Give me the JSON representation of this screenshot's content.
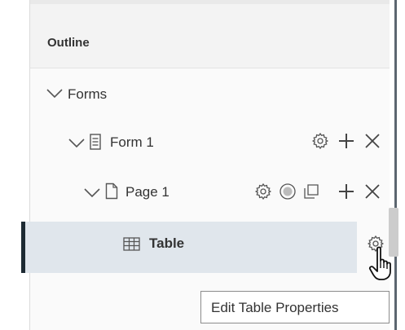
{
  "outline": {
    "title": "Outline",
    "tree": {
      "forms_label": "Forms",
      "form1_label": "Form 1",
      "page1_label": "Page 1",
      "table_label": "Table"
    }
  },
  "tooltip": {
    "text": "Edit Table Properties"
  },
  "colors": {
    "selected_background": "#e0e6ec",
    "selected_indicator": "#1d2a33",
    "icon": "#555555"
  },
  "icons": [
    "chevron-down-icon",
    "form-icon",
    "page-icon",
    "table-grid-icon",
    "gear-icon",
    "plus-icon",
    "close-icon",
    "check-circle-icon",
    "duplicate-icon",
    "hand-cursor-icon"
  ]
}
